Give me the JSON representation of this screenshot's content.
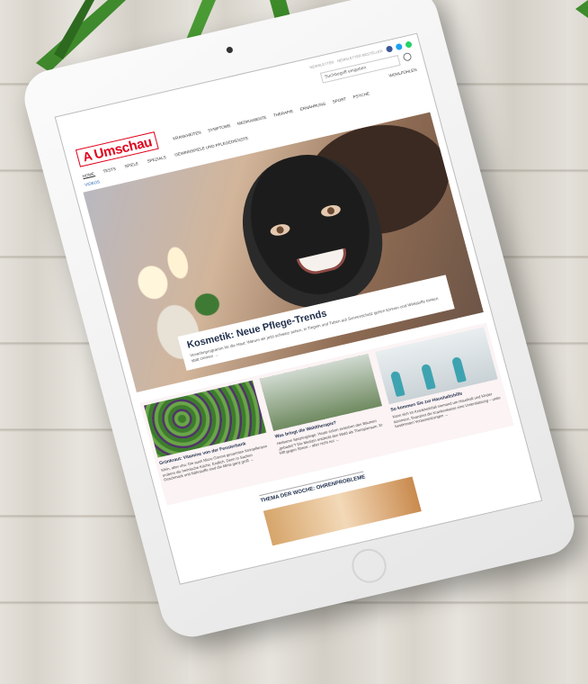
{
  "site": {
    "logo_text": "Umschau",
    "logo_symbol": "A",
    "topbar_links": [
      "NEWSLETTER",
      "NEWSLETTER BESTELLEN"
    ],
    "search_placeholder": "Suchbegriff eingeben",
    "main_nav": [
      "Krankheiten",
      "Symptome",
      "Medikamente",
      "Therapie",
      "Ernährung",
      "Sport",
      "Psyche"
    ],
    "right_nav": "Wohlfühlen",
    "tabs_row1": [
      "Home",
      "Tests",
      "Spiele",
      "Spezials",
      "Gewinnspiele und Pflegedienste"
    ],
    "tabs_row2": [
      "Videos"
    ]
  },
  "hero": {
    "title": "Kosmetik: Neue Pflege-Trends",
    "text": "Verwöhnprogramm für die Haut: Warum wir jetzt schwarz sehen, in Tiegeln und Tuben auf Sonnenschutz gehen können und Wirkstoffe trinken statt cremen →"
  },
  "articles": [
    {
      "title": "Grünkraut: Vitamine von der Fensterbank",
      "text": "Klein, aber oho: Die auch Micro Greens genannten Keimpflanzen erobern die heimische Küche. Endlich. Denn in Sachen Geschmack und Nährstoffe sind die Minis ganz groß →"
    },
    {
      "title": "Was bringt die Waldtherapie?",
      "text": "Heilsame Spaziergänge: Heute schon zwischen den Bäumen „gebadet“? Die Medizin entdeckt den Wald als Therapieraum. Er hilft gegen Stress – aber nicht nur →"
    },
    {
      "title": "So kommen Sie zur Haushaltshilfe",
      "text": "Kann sich im Krankheitsfall niemand um Haushalt und Kinder kümmern, finanziert die Krankenkasse eine Unterstützung – unter bestimmten Voraussetzungen →"
    }
  ],
  "theme_of_week": "THEMA DER WOCHE: OHRENPROBLEME",
  "colors": {
    "brand_red": "#e1001a",
    "heading_blue": "#1e2d4a",
    "link_blue": "#1b62b4"
  }
}
